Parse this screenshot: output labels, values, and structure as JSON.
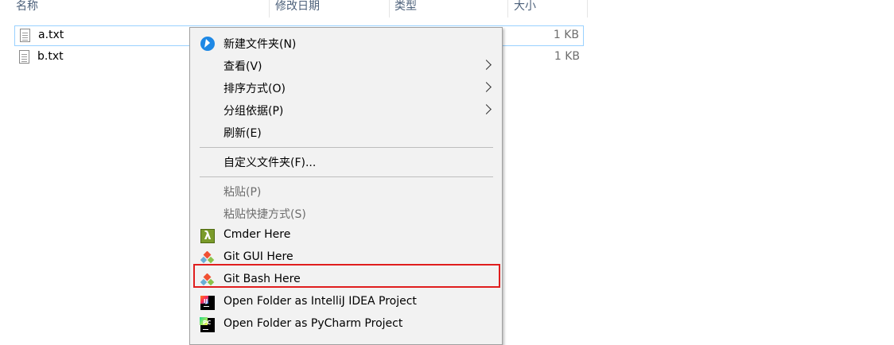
{
  "explorer": {
    "columns": {
      "name": "名称",
      "date": "修改日期",
      "type": "类型",
      "size": "大小"
    },
    "files": [
      {
        "name": "a.txt",
        "size": "1 KB",
        "selected": true
      },
      {
        "name": "b.txt",
        "size": "1 KB",
        "selected": false
      }
    ]
  },
  "context_menu": {
    "items": [
      {
        "label": "新建文件夹(N)",
        "icon": "new-folder-icon"
      },
      {
        "label": "查看(V)",
        "submenu": true
      },
      {
        "label": "排序方式(O)",
        "submenu": true
      },
      {
        "label": "分组依据(P)",
        "submenu": true
      },
      {
        "label": "刷新(E)"
      },
      {
        "label": "自定义文件夹(F)..."
      },
      {
        "label": "粘贴(P)",
        "disabled": true
      },
      {
        "label": "粘贴快捷方式(S)",
        "disabled": true
      },
      {
        "label": "Cmder Here",
        "icon": "cmder-icon"
      },
      {
        "label": "Git GUI Here",
        "icon": "git-gui-icon"
      },
      {
        "label": "Git Bash Here",
        "icon": "git-bash-icon",
        "highlighted": true
      },
      {
        "label": "Open Folder as IntelliJ IDEA Project",
        "icon": "intellij-idea-icon"
      },
      {
        "label": "Open Folder as PyCharm Project",
        "icon": "pycharm-icon"
      }
    ],
    "cmder_glyph": "λ",
    "idea_glyph": "IJ",
    "pycharm_glyph": "PC",
    "highlight_color": "#e01e1e"
  }
}
